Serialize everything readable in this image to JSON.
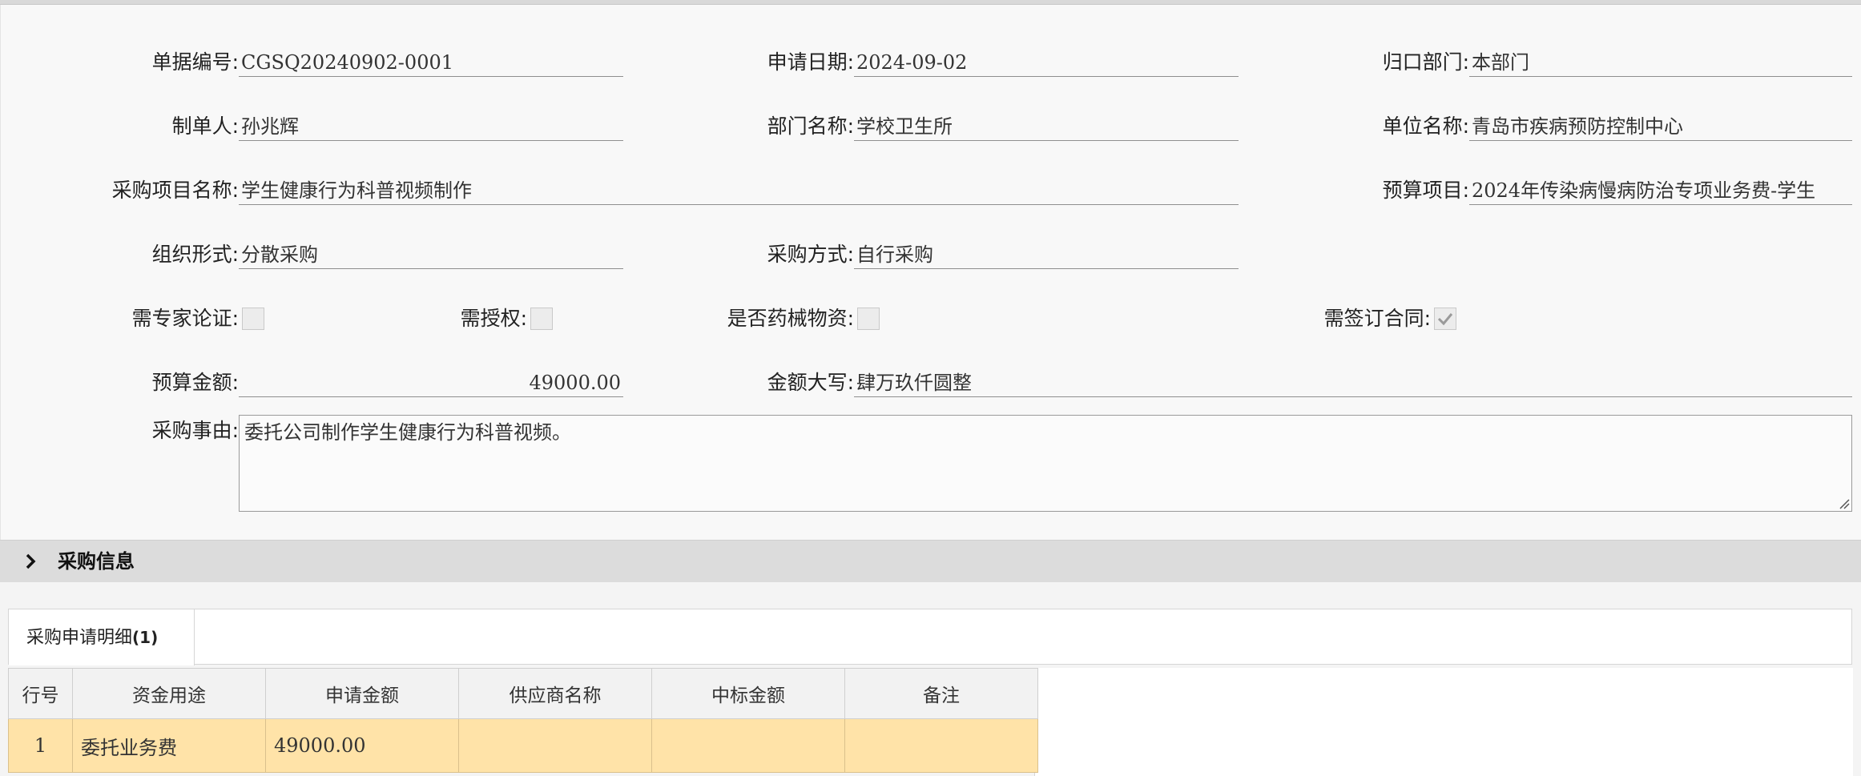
{
  "form": {
    "doc_no": {
      "label": "单据编号:",
      "value": "CGSQ20240902-0001"
    },
    "apply_date": {
      "label": "申请日期:",
      "value": "2024-09-02"
    },
    "home_dept": {
      "label": "归口部门:",
      "value": "本部门"
    },
    "maker": {
      "label": "制单人:",
      "value": "孙兆辉"
    },
    "dept_name": {
      "label": "部门名称:",
      "value": "学校卫生所"
    },
    "unit_name": {
      "label": "单位名称:",
      "value": "青岛市疾病预防控制中心"
    },
    "project_name": {
      "label": "采购项目名称:",
      "value": "学生健康行为科普视频制作"
    },
    "budget_item": {
      "label": "预算项目:",
      "value": "2024年传染病慢病防治专项业务费-学生"
    },
    "org_form": {
      "label": "组织形式:",
      "value": "分散采购"
    },
    "purchase_method": {
      "label": "采购方式:",
      "value": "自行采购"
    },
    "expert_review": {
      "label": "需专家论证:",
      "checked": false
    },
    "need_auth": {
      "label": "需授权:",
      "checked": false
    },
    "is_medical": {
      "label": "是否药械物资:",
      "checked": false
    },
    "need_contract": {
      "label": "需签订合同:",
      "checked": true
    },
    "budget_amount": {
      "label": "预算金额:",
      "value": "49000.00"
    },
    "amount_upper": {
      "label": "金额大写:",
      "value": "肆万玖仟圆整"
    },
    "reason": {
      "label": "采购事由:",
      "value": "委托公司制作学生健康行为科普视频。"
    }
  },
  "section": {
    "title": "采购信息"
  },
  "detail_tab": {
    "label": "采购申请明细",
    "count": "(1)"
  },
  "table": {
    "headers": [
      "行号",
      "资金用途",
      "申请金额",
      "供应商名称",
      "中标金额",
      "备注"
    ],
    "rows": [
      [
        "1",
        "委托业务费",
        "49000.00",
        "",
        "",
        ""
      ]
    ]
  }
}
